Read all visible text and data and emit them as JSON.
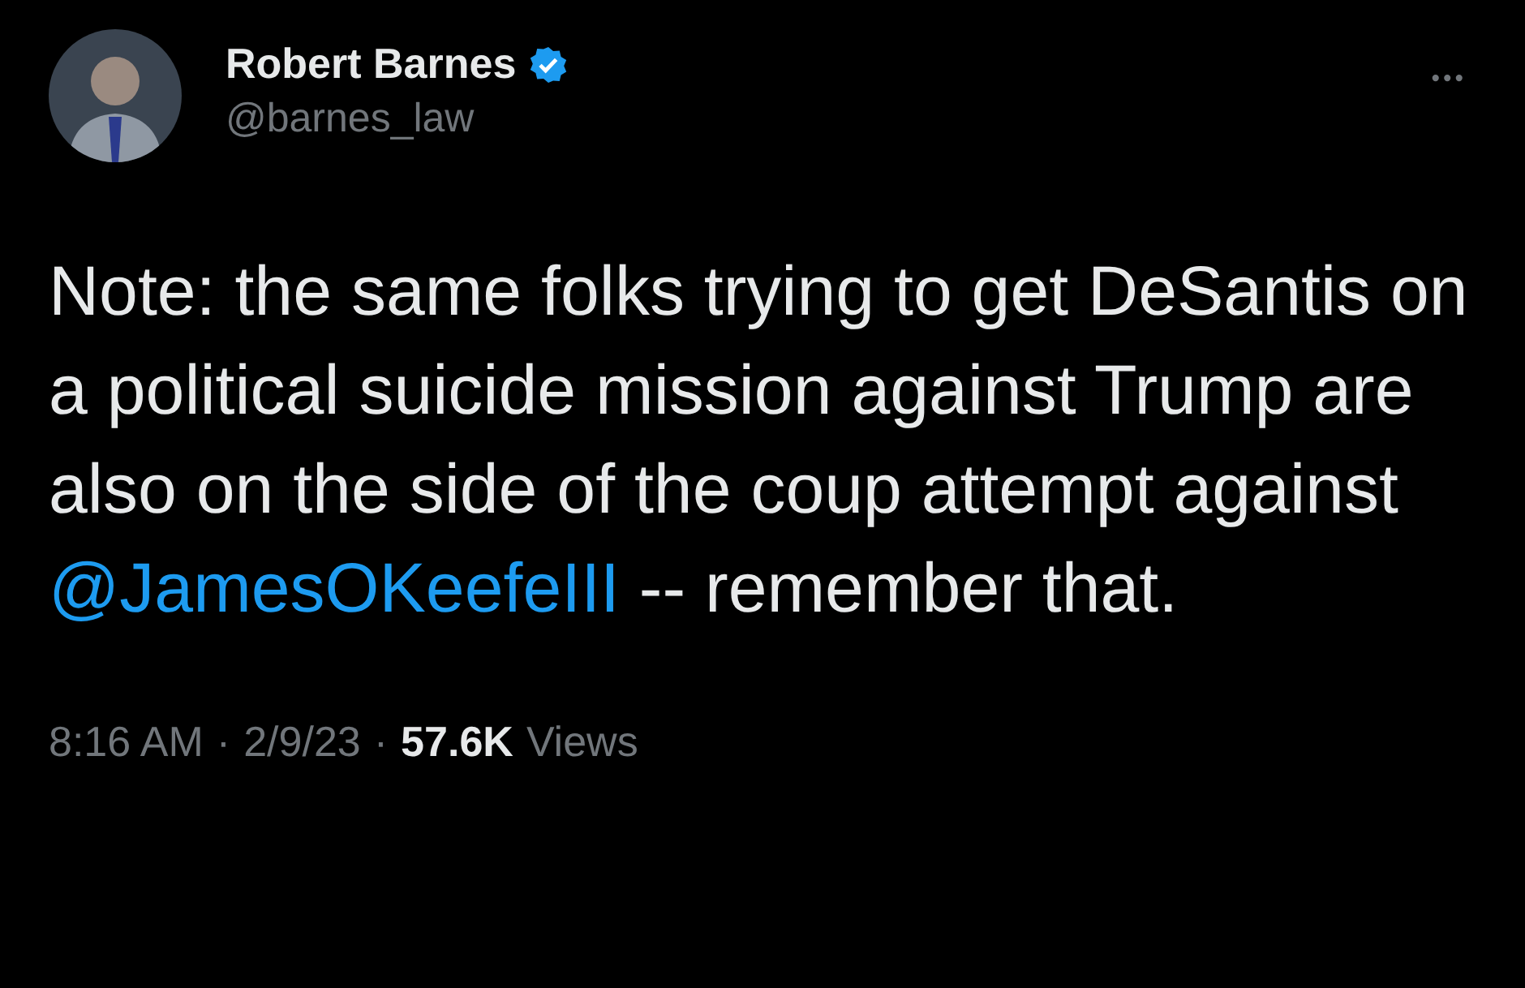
{
  "author": {
    "name": "Robert Barnes",
    "verified": true,
    "handle": "@barnes_law"
  },
  "more": "•••",
  "text_parts": [
    {
      "kind": "text",
      "text": "Note: the same folks trying to get DeSantis on a political suicide mission against Trump are also on the side of the coup attempt against "
    },
    {
      "kind": "mention",
      "text": "@JamesOKeefeIII"
    },
    {
      "kind": "text",
      "text": " -- remember that."
    }
  ],
  "meta": {
    "time": "8:16 AM",
    "separator_1": "·",
    "date": "2/9/23",
    "separator_2": "·",
    "views_count": "57.6K",
    "views_label": "Views"
  }
}
